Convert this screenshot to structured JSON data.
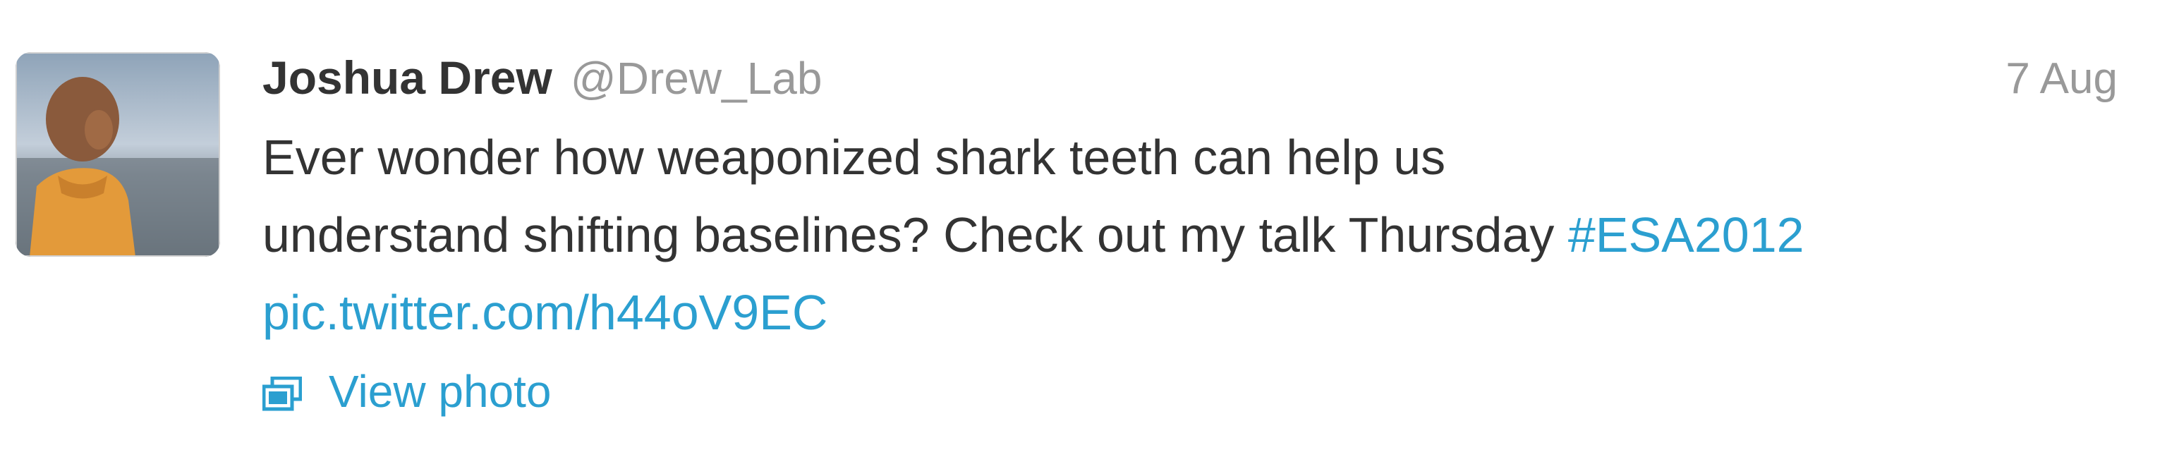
{
  "tweet": {
    "fullname": "Joshua Drew",
    "username": "@Drew_Lab",
    "timestamp": "7 Aug",
    "text_line1": "Ever wonder how weaponized shark teeth can help us",
    "text_line2_plain": "understand shifting baselines? Check out my talk Thursday ",
    "hashtag": "#ESA2012",
    "pic_link": "pic.twitter.com/h44oV9EC",
    "view_photo_label": "View photo",
    "view_photo_icon": "photo-stack-icon",
    "avatar_icon": "profile-photo"
  },
  "colors": {
    "link": "#2b9fd0",
    "text": "#333333",
    "muted": "#999999"
  }
}
